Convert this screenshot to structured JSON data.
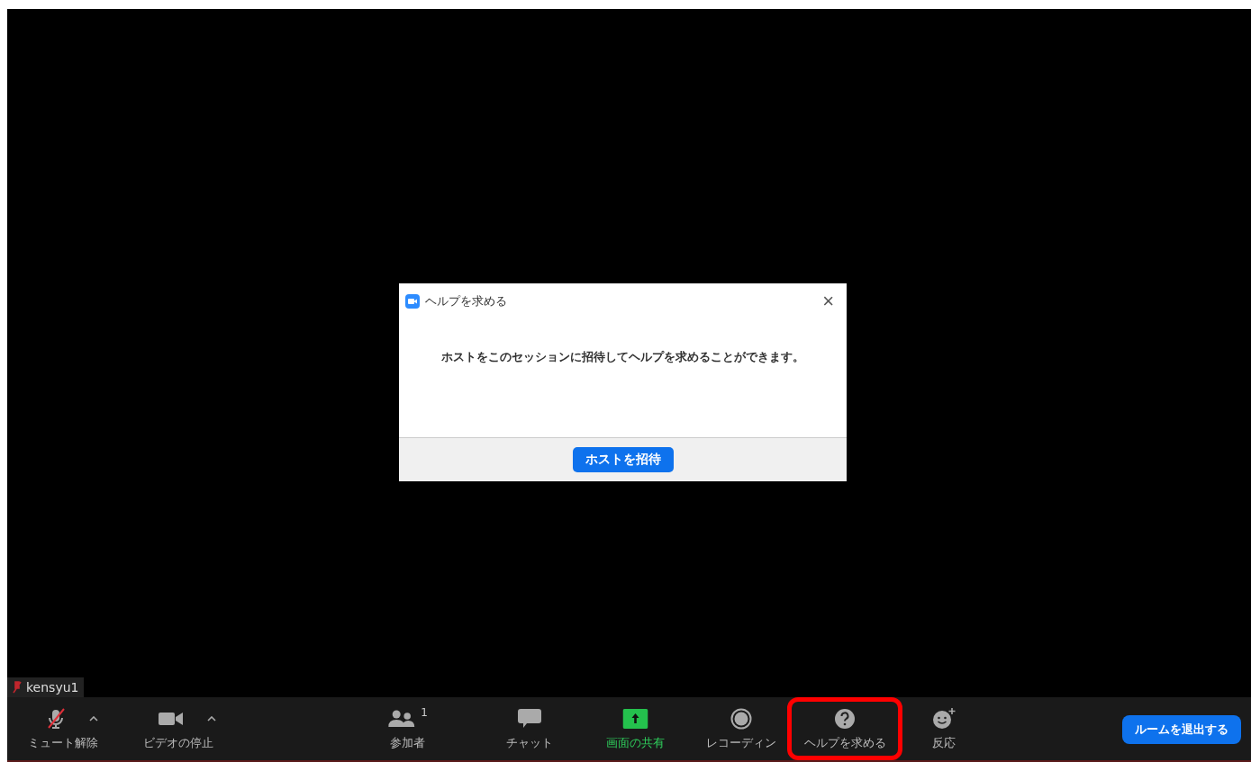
{
  "participant_tag": {
    "name": "kensyu1",
    "muted": true
  },
  "dialog": {
    "title": "ヘルプを求める",
    "close": "×",
    "message": "ホストをこのセッションに招待してヘルプを求めることができます。",
    "button": "ホストを招待"
  },
  "toolbar": {
    "items": [
      {
        "kind": "mic",
        "label": "ミュート解除",
        "caret": true,
        "accent": false,
        "highlighted": false
      },
      {
        "kind": "video",
        "label": "ビデオの停止",
        "caret": true,
        "accent": false,
        "highlighted": false
      },
      {
        "kind": "participants",
        "label": "参加者",
        "count": "1",
        "caret": false,
        "accent": false,
        "highlighted": false
      },
      {
        "kind": "chat",
        "label": "チャット",
        "caret": false,
        "accent": false,
        "highlighted": false
      },
      {
        "kind": "share",
        "label": "画面の共有",
        "caret": false,
        "accent": true,
        "highlighted": false
      },
      {
        "kind": "record",
        "label": "レコーディン",
        "caret": false,
        "accent": false,
        "highlighted": false
      },
      {
        "kind": "help",
        "label": "ヘルプを求める",
        "caret": false,
        "accent": false,
        "highlighted": true
      },
      {
        "kind": "reaction",
        "label": "反応",
        "caret": false,
        "accent": false,
        "highlighted": false
      }
    ],
    "leave_button": "ルームを退出する"
  }
}
